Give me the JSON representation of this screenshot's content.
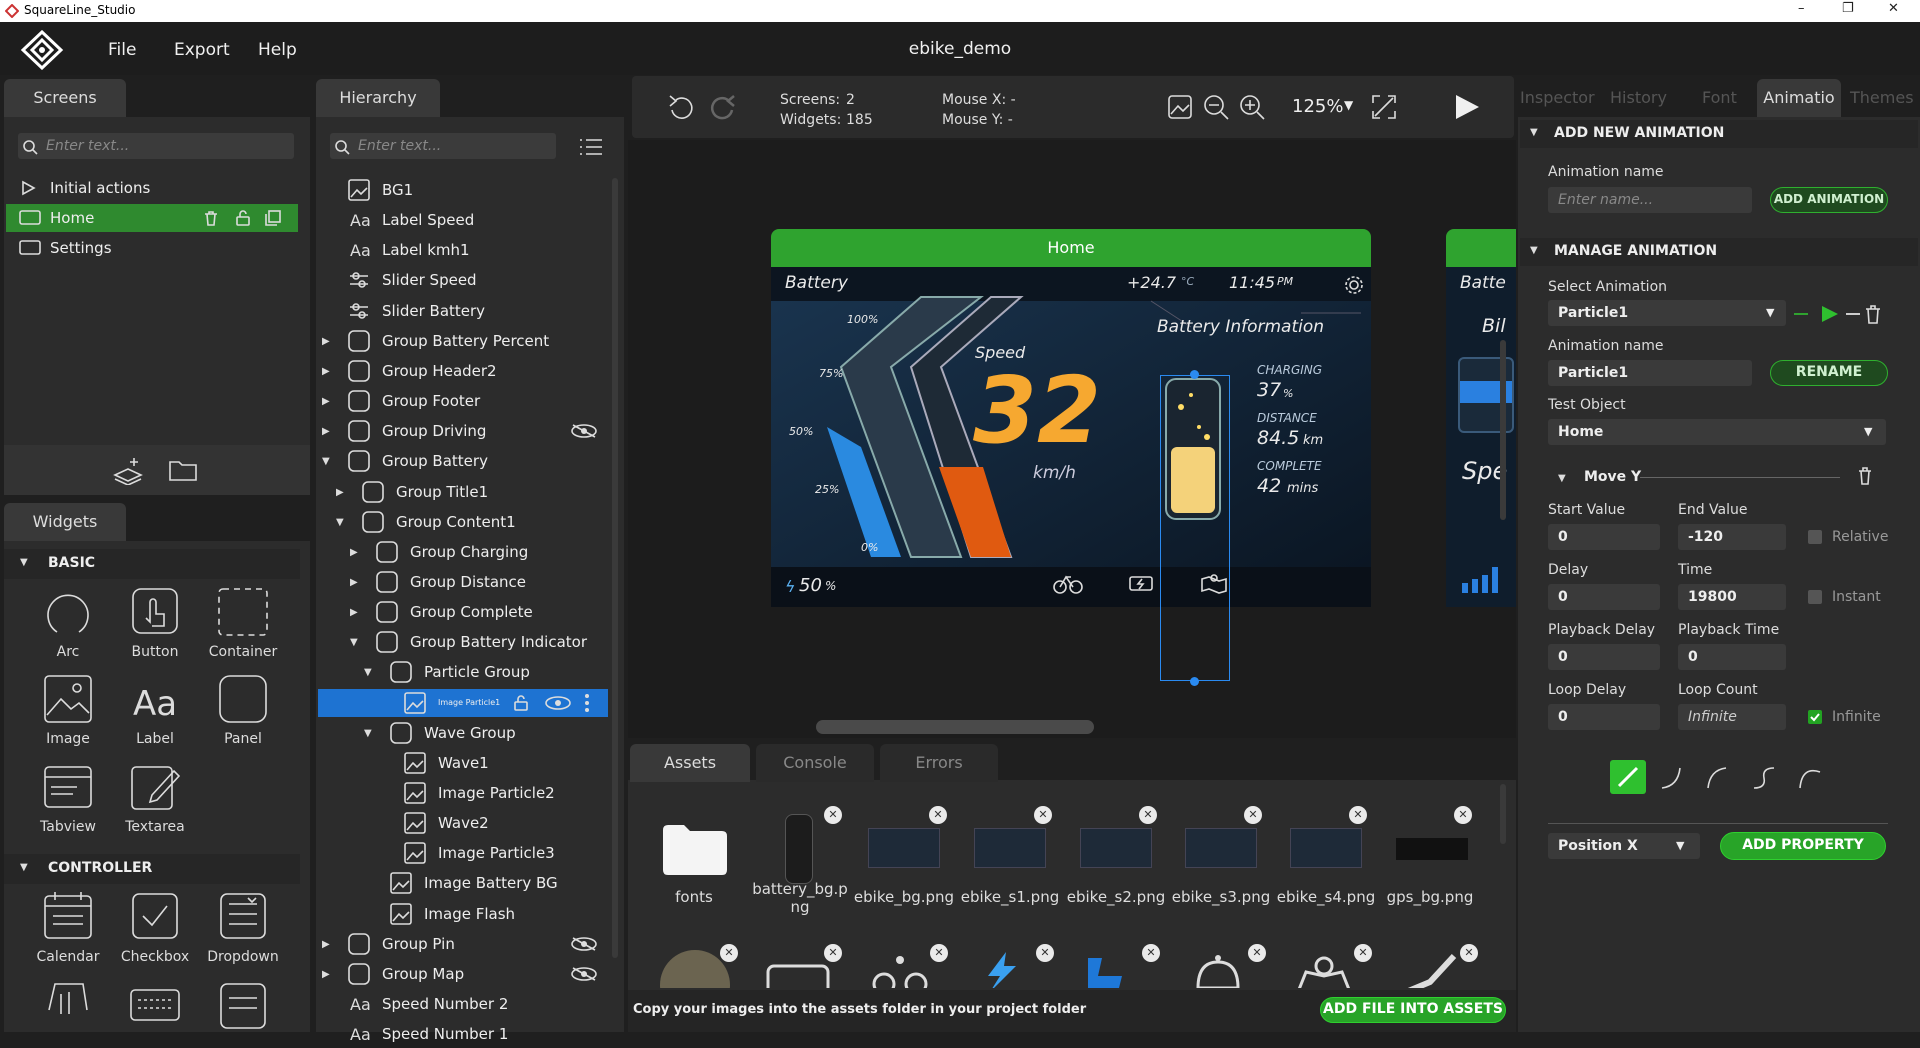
{
  "window": {
    "title": "SquareLine_Studio",
    "controls": [
      "–",
      "❐",
      "✕"
    ]
  },
  "menu": {
    "items": [
      "File",
      "Export",
      "Help"
    ],
    "project": "ebike_demo"
  },
  "screens": {
    "tab": "Screens",
    "search_placeholder": "Enter text...",
    "items": [
      {
        "label": "Initial actions"
      },
      {
        "label": "Home"
      },
      {
        "label": "Settings"
      }
    ]
  },
  "widgets": {
    "tab": "Widgets",
    "basic_title": "BASIC",
    "basic": [
      "Arc",
      "Button",
      "Container",
      "Image",
      "Label",
      "Panel",
      "Tabview",
      "Textarea"
    ],
    "controller_title": "CONTROLLER",
    "controller": [
      "Calendar",
      "Checkbox",
      "Dropdown"
    ]
  },
  "hierarchy": {
    "tab": "Hierarchy",
    "search_placeholder": "Enter text...",
    "items": [
      {
        "label": "BG1"
      },
      {
        "label": "Label Speed"
      },
      {
        "label": "Label kmh1"
      },
      {
        "label": "Slider Speed"
      },
      {
        "label": "Slider Battery"
      },
      {
        "label": "Group Battery Percent"
      },
      {
        "label": "Group Header2"
      },
      {
        "label": "Group Footer"
      },
      {
        "label": "Group Driving"
      },
      {
        "label": "Group Battery"
      },
      {
        "label": "Group Title1"
      },
      {
        "label": "Group Content1"
      },
      {
        "label": "Group Charging"
      },
      {
        "label": "Group Distance"
      },
      {
        "label": "Group Complete"
      },
      {
        "label": "Group Battery Indicator"
      },
      {
        "label": "Particle Group"
      },
      {
        "label": "Image Particle1"
      },
      {
        "label": "Wave Group"
      },
      {
        "label": "Wave1"
      },
      {
        "label": "Image Particle2"
      },
      {
        "label": "Wave2"
      },
      {
        "label": "Image Particle3"
      },
      {
        "label": "Image Battery BG"
      },
      {
        "label": "Image Flash"
      },
      {
        "label": "Group Pin"
      },
      {
        "label": "Group Map"
      },
      {
        "label": "Speed Number 2"
      },
      {
        "label": "Speed Number 1"
      }
    ]
  },
  "toolbar": {
    "screens_label": "Screens:",
    "screens_value": "2",
    "widgets_label": "Widgets:",
    "widgets_value": "185",
    "mouse_x": "Mouse X: -",
    "mouse_y": "Mouse Y: -",
    "zoom": "125%"
  },
  "device": {
    "header": "Home",
    "battery": "Battery",
    "temp": "+24.7",
    "temp_unit": "°C",
    "time": "11:45",
    "ampm": "PM",
    "battery_info": "Battery Information",
    "speed_label": "Speed",
    "speed": "32",
    "speed_unit": "km/h",
    "p100": "100%",
    "p75": "75%",
    "p50": "50%",
    "p25": "25%",
    "p0": "0%",
    "charging_label": "CHARGING",
    "charging_value": "37",
    "charging_unit": "%",
    "distance_label": "DISTANCE",
    "distance_value": "84.5",
    "distance_unit": "km",
    "complete_label": "COMPLETE",
    "complete_value": "42",
    "complete_unit": "mins",
    "battery_pct": "50",
    "battery_pct_unit": "%",
    "next_title": "Batte",
    "next_sub": "Bil",
    "next_speed": "Spe"
  },
  "bottom": {
    "tabs": [
      "Assets",
      "Console",
      "Errors"
    ],
    "footer_text": "Copy your images into the assets folder in your project folder",
    "add_button": "ADD FILE INTO ASSETS",
    "assets": [
      "fonts",
      "battery_bg.png",
      "ebike_bg.png",
      "ebike_s1.png",
      "ebike_s2.png",
      "ebike_s3.png",
      "ebike_s4.png",
      "gps_bg.png"
    ]
  },
  "inspector": {
    "tabs": [
      "Inspector",
      "History",
      "Font",
      "Animatio",
      "Themes"
    ],
    "add_section": "ADD NEW ANIMATION",
    "anim_name_label": "Animation name",
    "anim_name_placeholder": "Enter name...",
    "add_anim_button": "ADD ANIMATION",
    "manage_section": "MANAGE ANIMATION",
    "select_label": "Select Animation",
    "select_value": "Particle1",
    "anim_name2_label": "Animation name",
    "anim_name2_value": "Particle1",
    "rename_button": "RENAME",
    "test_object_label": "Test Object",
    "test_object_value": "Home",
    "move_title": "Move Y",
    "start_label": "Start Value",
    "start_value": "0",
    "end_label": "End Value",
    "end_value": "-120",
    "relative_label": "Relative",
    "delay_label": "Delay",
    "delay_value": "0",
    "time_label": "Time",
    "time_value": "19800",
    "instant_label": "Instant",
    "pdelay_label": "Playback Delay",
    "pdelay_value": "0",
    "ptime_label": "Playback Time",
    "ptime_value": "0",
    "loop_delay_label": "Loop Delay",
    "loop_delay_value": "0",
    "loop_count_label": "Loop Count",
    "loop_count_value": "Infinite",
    "infinite_label": "Infinite",
    "property_value": "Position X",
    "add_property_button": "ADD PROPERTY"
  },
  "colors": {
    "accent_green": "#2fa32f",
    "selection_blue": "#1e73d2"
  }
}
